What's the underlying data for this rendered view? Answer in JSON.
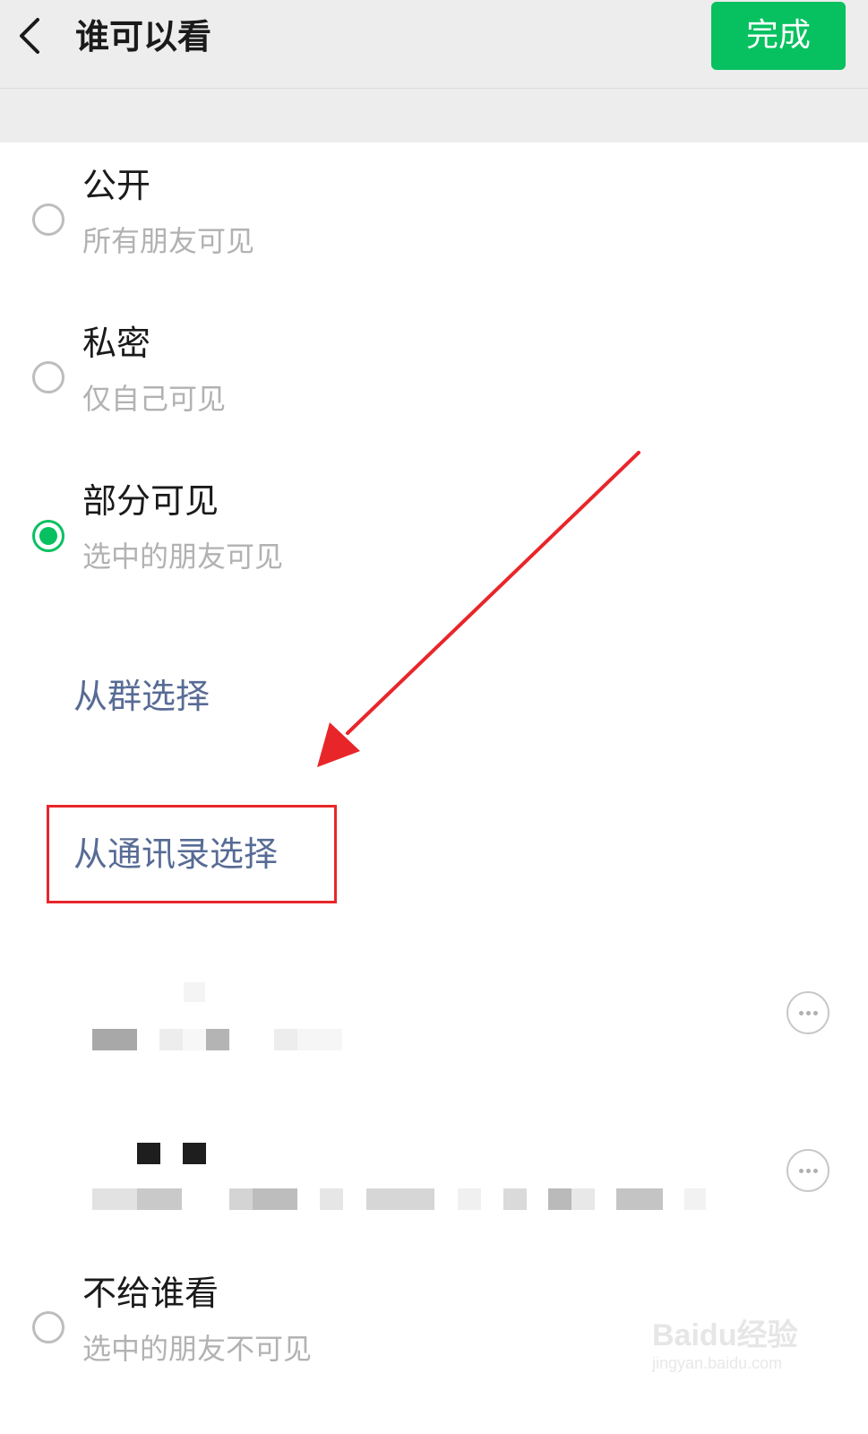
{
  "header": {
    "title": "谁可以看",
    "done_label": "完成"
  },
  "options": [
    {
      "title": "公开",
      "subtitle": "所有朋友可见",
      "selected": false
    },
    {
      "title": "私密",
      "subtitle": "仅自己可见",
      "selected": false
    },
    {
      "title": "部分可见",
      "subtitle": "选中的朋友可见",
      "selected": true
    },
    {
      "title": "不给谁看",
      "subtitle": "选中的朋友不可见",
      "selected": false
    }
  ],
  "partial_actions": {
    "from_group_label": "从群选择",
    "from_contacts_label": "从通讯录选择"
  },
  "colors": {
    "accent": "#07c160",
    "link": "#576b95",
    "annotation": "#e8262a"
  },
  "watermark": {
    "brand": "Bai",
    "brand_suffix": "du经验",
    "site": "jingyan.baidu.com"
  }
}
